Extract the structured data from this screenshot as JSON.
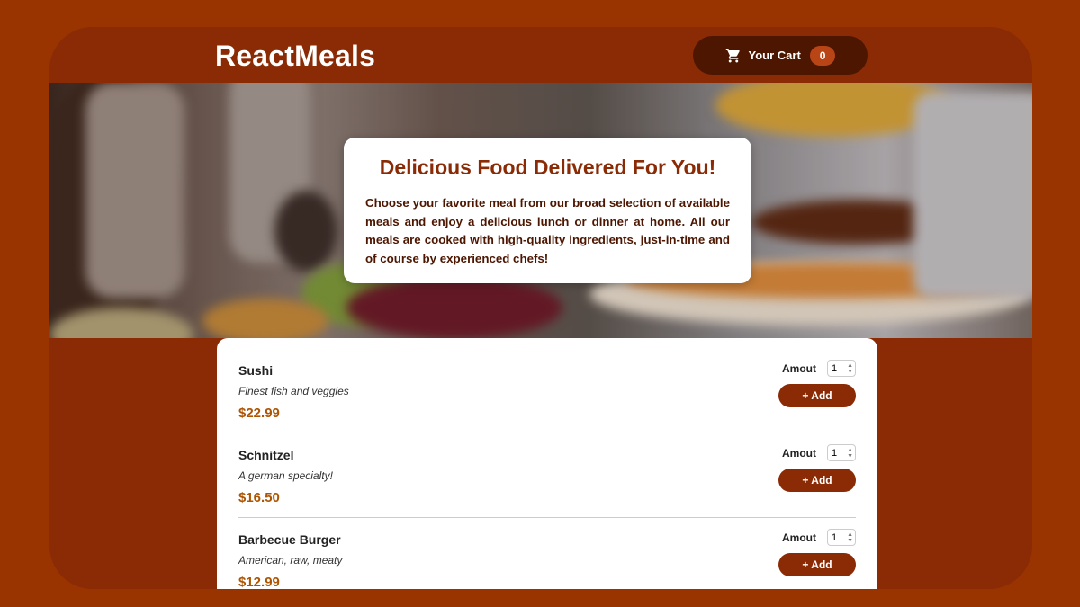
{
  "header": {
    "logo": "ReactMeals",
    "cart": {
      "label": "Your Cart",
      "count": "0",
      "icon": "shopping-cart-icon"
    }
  },
  "hero": {
    "title": "Delicious Food Delivered For You!",
    "text": "Choose your favorite meal from our broad selection of available meals and enjoy a delicious lunch or dinner at home. All our meals are cooked with high-quality ingredients, just-in-time and of course by experienced chefs!"
  },
  "meals": [
    {
      "name": "Sushi",
      "description": "Finest fish and veggies",
      "price": "$22.99",
      "amount_label": "Amout",
      "amount": "1",
      "add_label": "+ Add"
    },
    {
      "name": "Schnitzel",
      "description": "A german specialty!",
      "price": "$16.50",
      "amount_label": "Amout",
      "amount": "1",
      "add_label": "+ Add"
    },
    {
      "name": "Barbecue Burger",
      "description": "American, raw, meaty",
      "price": "$12.99",
      "amount_label": "Amout",
      "amount": "1",
      "add_label": "+ Add"
    }
  ],
  "colors": {
    "page_background": "#993300",
    "frame": "#8a2b06",
    "cart_button": "#4d1601",
    "cart_badge": "#b94517",
    "price": "#ad5502",
    "hero_title": "#8a2b06"
  }
}
